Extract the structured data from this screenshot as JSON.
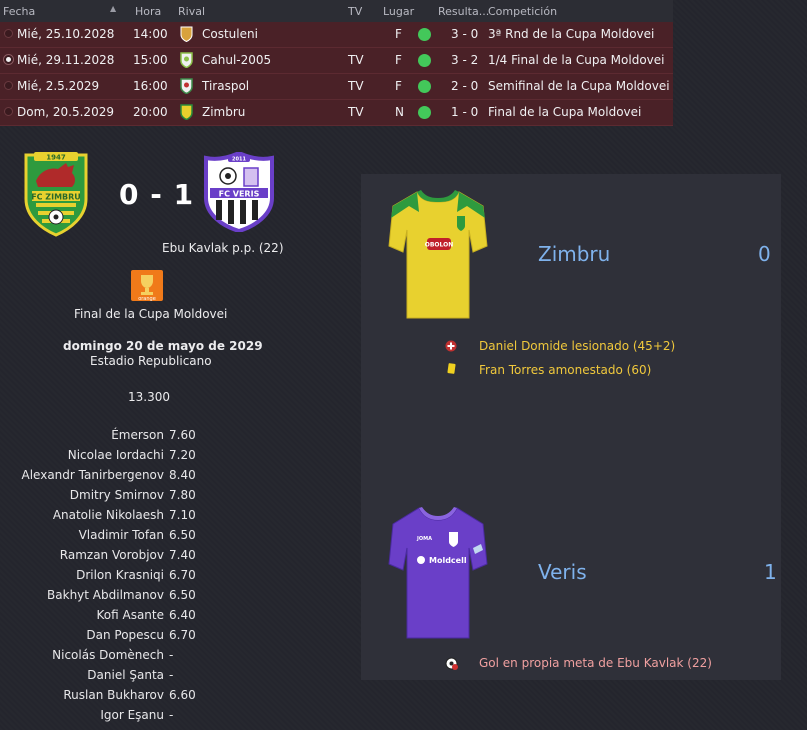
{
  "table": {
    "headers": {
      "fecha": "Fecha",
      "hora": "Hora",
      "rival": "Rival",
      "tv": "TV",
      "lugar": "Lugar",
      "resultado": "Resulta...",
      "competicion": "Competición"
    },
    "rows": [
      {
        "fecha": "Mié, 25.10.2028",
        "hora": "14:00",
        "rival": "Costuleni",
        "tv": "",
        "lugar": "F",
        "resultado": "3 - 0",
        "competicion": "3ª Rnd de la Cupa Moldovei",
        "badge_color": "#d8a23c",
        "selected": false
      },
      {
        "fecha": "Mié, 29.11.2028",
        "hora": "15:00",
        "rival": "Cahul-2005",
        "tv": "TV",
        "lugar": "F",
        "resultado": "3 - 2",
        "competicion": "1/4 Final de la Cupa Moldovei",
        "badge_color": "#8cc04a",
        "selected": true
      },
      {
        "fecha": "Mié, 2.5.2029",
        "hora": "16:00",
        "rival": "Tiraspol",
        "tv": "TV",
        "lugar": "F",
        "resultado": "2 - 0",
        "competicion": "Semifinal de la Cupa Moldovei",
        "badge_color": "#3c8c4a",
        "selected": false
      },
      {
        "fecha": "Dom, 20.5.2029",
        "hora": "20:00",
        "rival": "Zimbru",
        "tv": "TV",
        "lugar": "N",
        "resultado": "1 - 0",
        "competicion": "Final de la Cupa Moldovei",
        "badge_color": "#e8d02c",
        "selected": false
      }
    ]
  },
  "match": {
    "home_crest_text": "FC ZIMBRU",
    "home_crest_year": "1947",
    "away_crest_text": "FC VERIS",
    "away_crest_year": "2011",
    "score": "0 - 1",
    "scorer": "Ebu Kavlak p.p. (22)",
    "trophy_text": "orange",
    "competition": "Final de la Cupa Moldovei",
    "date": "domingo 20 de mayo de 2029",
    "stadium": "Estadio Republicano",
    "attendance": "13.300"
  },
  "ratings": [
    {
      "name": "Émerson",
      "value": "7.60"
    },
    {
      "name": "Nicolae Iordachi",
      "value": "7.20"
    },
    {
      "name": "Alexandr Tanirbergenov",
      "value": "8.40"
    },
    {
      "name": "Dmitry Smirnov",
      "value": "7.80"
    },
    {
      "name": "Anatolie Nikolaesh",
      "value": "7.10"
    },
    {
      "name": "Vladimir Tofan",
      "value": "6.50"
    },
    {
      "name": "Ramzan Vorobjov",
      "value": "7.40"
    },
    {
      "name": "Drilon Krasniqi",
      "value": "6.70"
    },
    {
      "name": "Bakhyt Abdilmanov",
      "value": "6.50"
    },
    {
      "name": "Kofi Asante",
      "value": "6.40"
    },
    {
      "name": "Dan Popescu",
      "value": "6.70"
    },
    {
      "name": "Nicolás Domènech",
      "value": "-"
    },
    {
      "name": "Daniel Şanta",
      "value": "-"
    },
    {
      "name": "Ruslan Bukharov",
      "value": "6.60"
    },
    {
      "name": "Igor Eşanu",
      "value": "-"
    }
  ],
  "home_team": {
    "name": "Zimbru",
    "score": "0",
    "shirt_sponsor": "OBOLON",
    "events": [
      {
        "icon": "injury-icon",
        "text": "Daniel Domide lesionado (45+2)"
      },
      {
        "icon": "yellow-card-icon",
        "text": "Fran Torres amonestado (60)"
      }
    ]
  },
  "away_team": {
    "name": "Veris",
    "score": "1",
    "shirt_sponsor": "Moldcell",
    "shirt_brand": "JOMA",
    "events": [
      {
        "icon": "own-goal-icon",
        "text": "Gol en propia meta de Ebu Kavlak (22)"
      }
    ]
  },
  "colors": {
    "row_bg": "#4a2127",
    "win_dot": "#43c85a",
    "team_name": "#7fb2ec",
    "event_text": "#f0c83c",
    "home_shirt": "#e8d12f",
    "away_shirt": "#6a3fc8"
  }
}
